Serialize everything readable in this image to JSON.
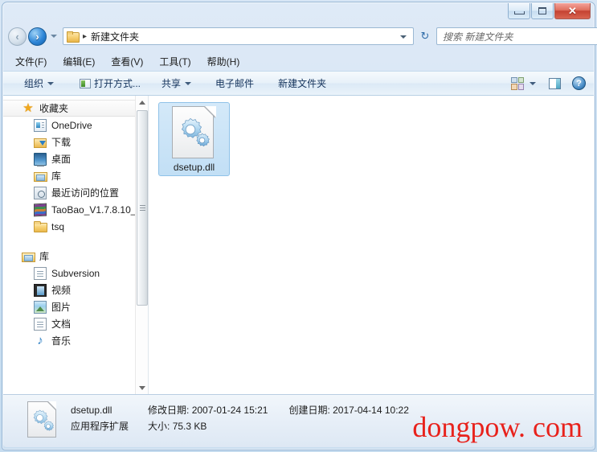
{
  "window": {
    "minimize_label": "最小化",
    "maximize_label": "最大化",
    "close_label": "✕"
  },
  "navbar": {
    "back_label": "‹",
    "forward_label": "›",
    "recent_caret": "▾",
    "breadcrumb_separator": "▸",
    "breadcrumb_path": "新建文件夹",
    "refresh_label": "↻",
    "search_placeholder": "搜索 新建文件夹"
  },
  "menubar": {
    "items": [
      {
        "label": "文件(F)"
      },
      {
        "label": "编辑(E)"
      },
      {
        "label": "查看(V)"
      },
      {
        "label": "工具(T)"
      },
      {
        "label": "帮助(H)"
      }
    ]
  },
  "toolbar": {
    "organize_label": "组织",
    "open_with_label": "打开方式...",
    "share_label": "共享",
    "email_label": "电子邮件",
    "new_folder_label": "新建文件夹",
    "help_glyph": "?"
  },
  "sidebar": {
    "groups": [
      {
        "header": "收藏夹",
        "header_icon": "star-icon",
        "items": [
          {
            "label": "OneDrive",
            "icon": "onedrive-icon"
          },
          {
            "label": "下载",
            "icon": "downloads-icon"
          },
          {
            "label": "桌面",
            "icon": "desktop-icon"
          },
          {
            "label": "库",
            "icon": "library-icon"
          },
          {
            "label": "最近访问的位置",
            "icon": "recent-places-icon"
          },
          {
            "label": "TaoBao_V1.7.8.10_",
            "icon": "archive-icon"
          },
          {
            "label": "tsq",
            "icon": "folder-icon"
          }
        ]
      },
      {
        "header": "库",
        "header_icon": "library-icon",
        "items": [
          {
            "label": "Subversion",
            "icon": "document-icon"
          },
          {
            "label": "视频",
            "icon": "video-icon"
          },
          {
            "label": "图片",
            "icon": "picture-icon"
          },
          {
            "label": "文档",
            "icon": "document-icon"
          },
          {
            "label": "音乐",
            "icon": "music-icon"
          }
        ]
      }
    ],
    "scroll_up_label": "▲",
    "scroll_down_label": "▼"
  },
  "content": {
    "files": [
      {
        "name": "dsetup.dll",
        "selected": true,
        "icon": "dll-gear-icon"
      }
    ]
  },
  "status": {
    "file_name": "dsetup.dll",
    "file_kind": "应用程序扩展",
    "modified_label": "修改日期:",
    "modified_value": "2007-01-24 15:21",
    "created_label": "创建日期:",
    "created_value": "2017-04-14 10:22",
    "size_label": "大小:",
    "size_value": "75.3 KB",
    "watermark": "dongpow. com"
  },
  "colors": {
    "frame": "#cadef0",
    "selection": "#c2dff5",
    "selection_border": "#8fc2e8",
    "accent": "#2f6ca8",
    "watermark": "#e8221c",
    "close_button": "#c44232"
  }
}
